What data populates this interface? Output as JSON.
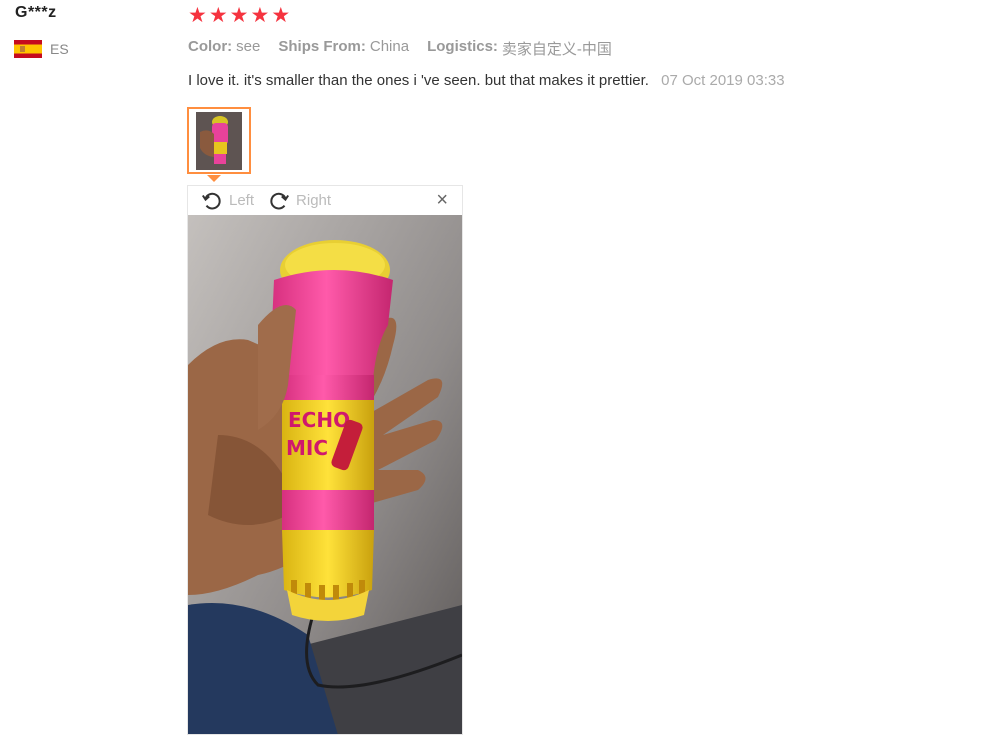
{
  "user": {
    "name": "G***z",
    "country_code": "ES",
    "flag_icon": "spain-flag-icon"
  },
  "review": {
    "rating": 5,
    "stars": [
      "★",
      "★",
      "★",
      "★",
      "★"
    ],
    "meta": [
      {
        "key": "Color:",
        "value": "see"
      },
      {
        "key": "Ships From:",
        "value": "China"
      },
      {
        "key": "Logistics:",
        "value": "卖家自定义-中国"
      }
    ],
    "text": "I love it. it's smaller than the ones i 've seen. but that makes it prettier.",
    "date": "07 Oct 2019 03:33"
  },
  "viewer": {
    "rotate_left_label": "Left",
    "rotate_right_label": "Right",
    "close_icon": "×",
    "photo_subject": {
      "label_line1": "ECHO",
      "label_line2": "MIC"
    }
  },
  "colors": {
    "star": "#f5333f",
    "thumb_border": "#ff8e3f"
  }
}
